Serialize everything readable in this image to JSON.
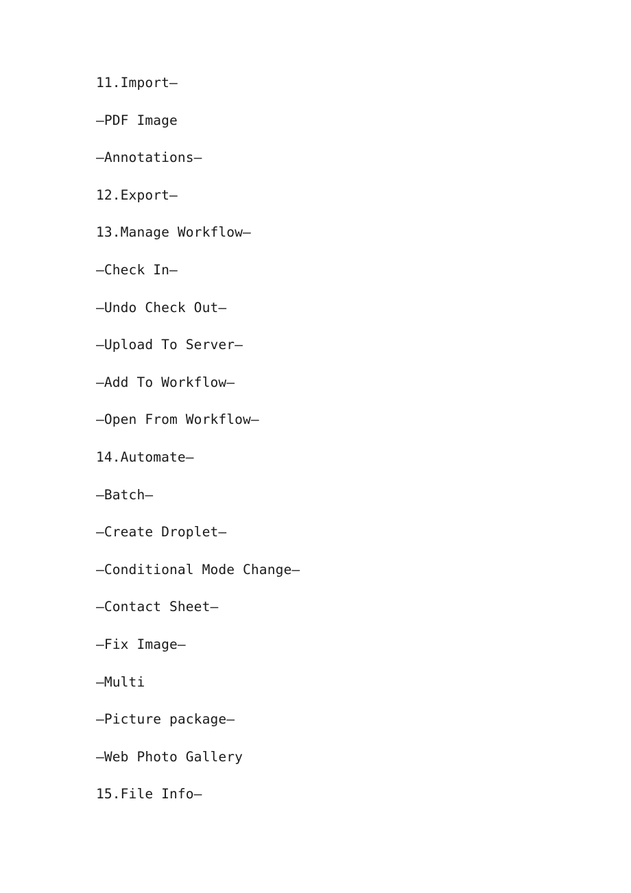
{
  "document": {
    "background_color": "#ffffff",
    "text_color": "#1a1a1a",
    "dash_glyph": "—"
  },
  "outline": {
    "lines": [
      {
        "text": "11.Import—",
        "level": 1,
        "number": "11.",
        "label": "Import"
      },
      {
        "text": "—PDF Image",
        "level": 2,
        "number": "",
        "label": "PDF Image"
      },
      {
        "text": "—Annotations—",
        "level": 2,
        "number": "",
        "label": "Annotations"
      },
      {
        "text": "12.Export—",
        "level": 1,
        "number": "12.",
        "label": "Export"
      },
      {
        "text": "13.Manage Workflow—",
        "level": 1,
        "number": "13.",
        "label": "Manage Workflow"
      },
      {
        "text": "—Check In—",
        "level": 2,
        "number": "",
        "label": "Check In"
      },
      {
        "text": "—Undo Check Out—",
        "level": 2,
        "number": "",
        "label": "Undo Check Out"
      },
      {
        "text": "—Upload To Server—",
        "level": 2,
        "number": "",
        "label": "Upload To Server"
      },
      {
        "text": "—Add To Workflow—",
        "level": 2,
        "number": "",
        "label": "Add To Workflow"
      },
      {
        "text": "—Open From Workflow—",
        "level": 2,
        "number": "",
        "label": "Open From Workflow"
      },
      {
        "text": "14.Automate—",
        "level": 1,
        "number": "14.",
        "label": "Automate"
      },
      {
        "text": "—Batch—",
        "level": 2,
        "number": "",
        "label": "Batch"
      },
      {
        "text": "—Create Droplet—",
        "level": 2,
        "number": "",
        "label": "Create Droplet"
      },
      {
        "text": "—Conditional Mode Change—",
        "level": 2,
        "number": "",
        "label": "Conditional Mode Change"
      },
      {
        "text": "—Contact Sheet—",
        "level": 2,
        "number": "",
        "label": "Contact Sheet"
      },
      {
        "text": "—Fix Image—",
        "level": 2,
        "number": "",
        "label": "Fix Image"
      },
      {
        "text": "—Multi",
        "level": 2,
        "number": "",
        "label": "Multi"
      },
      {
        "text": "—Picture package—",
        "level": 2,
        "number": "",
        "label": "Picture package"
      },
      {
        "text": "—Web Photo Gallery",
        "level": 2,
        "number": "",
        "label": "Web Photo Gallery"
      },
      {
        "text": "15.File Info—",
        "level": 1,
        "number": "15.",
        "label": "File Info"
      }
    ]
  }
}
